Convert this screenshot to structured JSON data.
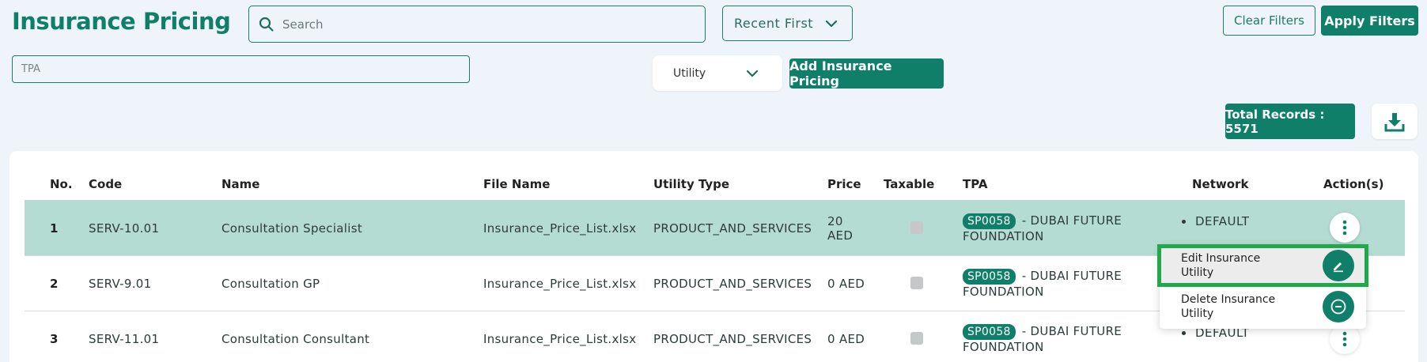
{
  "header": {
    "title": "Insurance Pricing",
    "search_placeholder": "Search",
    "sort_value": "Recent First",
    "clear_filters_label": "Clear Filters",
    "apply_filters_label": "Apply Filters"
  },
  "filters": {
    "tpa_placeholder": "TPA",
    "utility_value": "Utility",
    "add_label": "Add Insurance Pricing"
  },
  "summary": {
    "total_records_label": "Total Records : 5571"
  },
  "table": {
    "headers": {
      "no": "No.",
      "code": "Code",
      "name": "Name",
      "file_name": "File Name",
      "utility_type": "Utility Type",
      "price": "Price",
      "taxable": "Taxable",
      "tpa": "TPA",
      "network": "Network",
      "actions": "Action(s)"
    },
    "rows": [
      {
        "no": "1",
        "code": "SERV-10.01",
        "name": "Consultation Specialist",
        "file_name": "Insurance_Price_List.xlsx",
        "utility_type": "PRODUCT_AND_SERVICES",
        "price_line1": "20",
        "price_line2": "AED",
        "tpa_code": "SP0058",
        "tpa_name": "- DUBAI FUTURE FOUNDATION",
        "network": "DEFAULT"
      },
      {
        "no": "2",
        "code": "SERV-9.01",
        "name": "Consultation GP",
        "file_name": "Insurance_Price_List.xlsx",
        "utility_type": "PRODUCT_AND_SERVICES",
        "price": "0 AED",
        "tpa_code": "SP0058",
        "tpa_name": "- DUBAI FUTURE FOUNDATION"
      },
      {
        "no": "3",
        "code": "SERV-11.01",
        "name": "Consultation Consultant",
        "file_name": "Insurance_Price_List.xlsx",
        "utility_type": "PRODUCT_AND_SERVICES",
        "price": "0 AED",
        "tpa_code": "SP0058",
        "tpa_name": "- DUBAI FUTURE FOUNDATION",
        "network": "DEFAULT"
      }
    ]
  },
  "action_menu": {
    "edit_label": "Edit Insurance Utility",
    "delete_label": "Delete Insurance Utility"
  },
  "colors": {
    "brand": "#0f7f6a",
    "highlight_row": "#b4dcd2",
    "focus_outline": "#21a84a"
  }
}
